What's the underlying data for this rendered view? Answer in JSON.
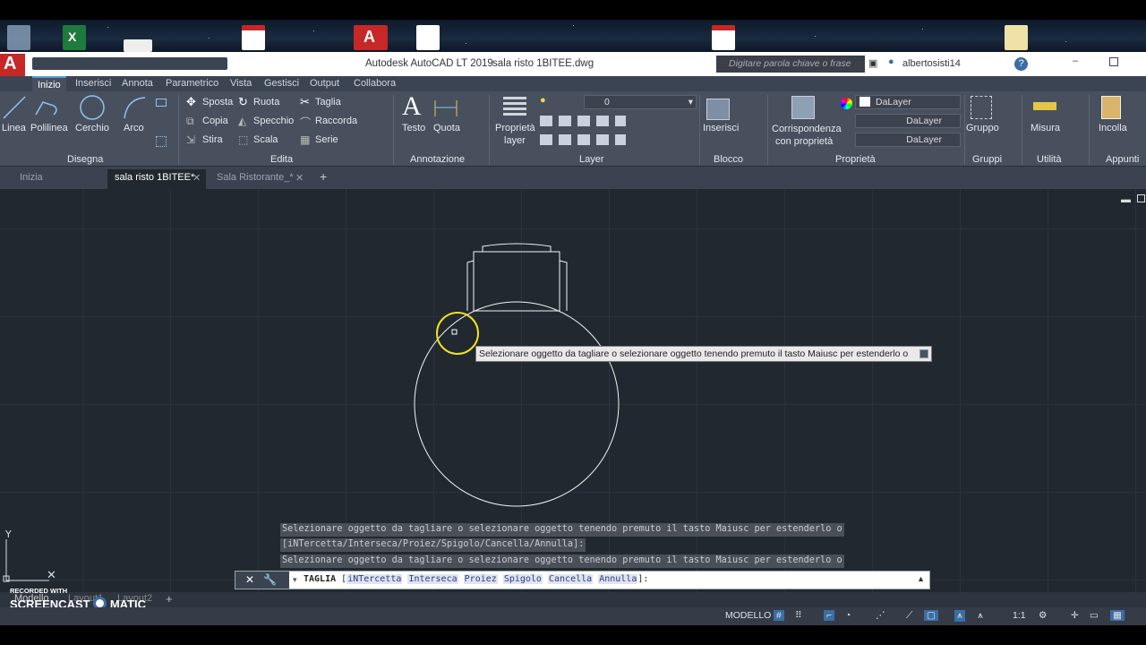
{
  "window": {
    "app_title": "Autodesk AutoCAD LT 2019",
    "file_name": "sala risto 1BITEE.dwg",
    "search_placeholder": "Digitare parola chiave o frase",
    "user": "albertosisti14"
  },
  "ribbon_tabs": [
    "Inizio",
    "Inserisci",
    "Annota",
    "Parametrico",
    "Vista",
    "Gestisci",
    "Output",
    "Collabora"
  ],
  "ribbon": {
    "draw": {
      "linea": "Linea",
      "polilinea": "Polilinea",
      "cerchio": "Cerchio",
      "arco": "Arco",
      "panel": "Disegna"
    },
    "edit": {
      "sposta": "Sposta",
      "ruota": "Ruota",
      "taglia": "Taglia",
      "copia": "Copia",
      "specchio": "Specchio",
      "raccorda": "Raccorda",
      "stira": "Stira",
      "scala": "Scala",
      "serie": "Serie",
      "panel": "Edita"
    },
    "annot": {
      "testo": "Testo",
      "quota": "Quota",
      "panel": "Annotazione"
    },
    "layer": {
      "prop1": "Proprietà",
      "prop2": "layer",
      "current": "0",
      "panel": "Layer"
    },
    "block": {
      "inserisci": "Inserisci",
      "panel": "Blocco"
    },
    "props": {
      "match1": "Corrispondenza",
      "match2": "con proprietà",
      "color": "DaLayer",
      "linetype": "DaLayer",
      "lineweight": "DaLayer",
      "panel": "Proprietà"
    },
    "groups": {
      "gruppo": "Gruppo",
      "panel": "Gruppi"
    },
    "util": {
      "misura": "Misura",
      "panel": "Utilità"
    },
    "clip": {
      "incolla": "Incolla",
      "panel": "Appunti"
    }
  },
  "doc_tabs": [
    "Inizia",
    "sala risto 1BITEE*",
    "Sala Ristorante_*"
  ],
  "tooltip": "Selezionare oggetto da tagliare o selezionare oggetto tenendo premuto il tasto Maiusc per estenderlo o",
  "command_history": [
    "Selezionare oggetto da tagliare o selezionare oggetto tenendo premuto il tasto Maiusc per estenderlo o",
    "[iNTercetta/Interseca/Proiez/Spigolo/Cancella/Annulla]:",
    "Selezionare oggetto da tagliare o selezionare oggetto tenendo premuto il tasto Maiusc per estenderlo o"
  ],
  "command_line": {
    "command": "TAGLIA",
    "open": "[",
    "options": [
      "iNTercetta",
      "Interseca",
      "Proiez",
      "Spigolo",
      "Cancella",
      "Annulla"
    ],
    "close": "]:"
  },
  "layout_tabs": [
    "Modello",
    "Layout1",
    "Layout2"
  ],
  "watermark": {
    "line1": "RECORDED WITH",
    "line2": "SCREENCAST",
    "line3": "MATIC"
  },
  "status": {
    "space": "MODELLO",
    "scale": "1:1"
  },
  "colors": {
    "canvas": "#212830",
    "ribbon": "#48505e",
    "cursor": "#f2e31c",
    "accent": "#5b9bd5"
  }
}
